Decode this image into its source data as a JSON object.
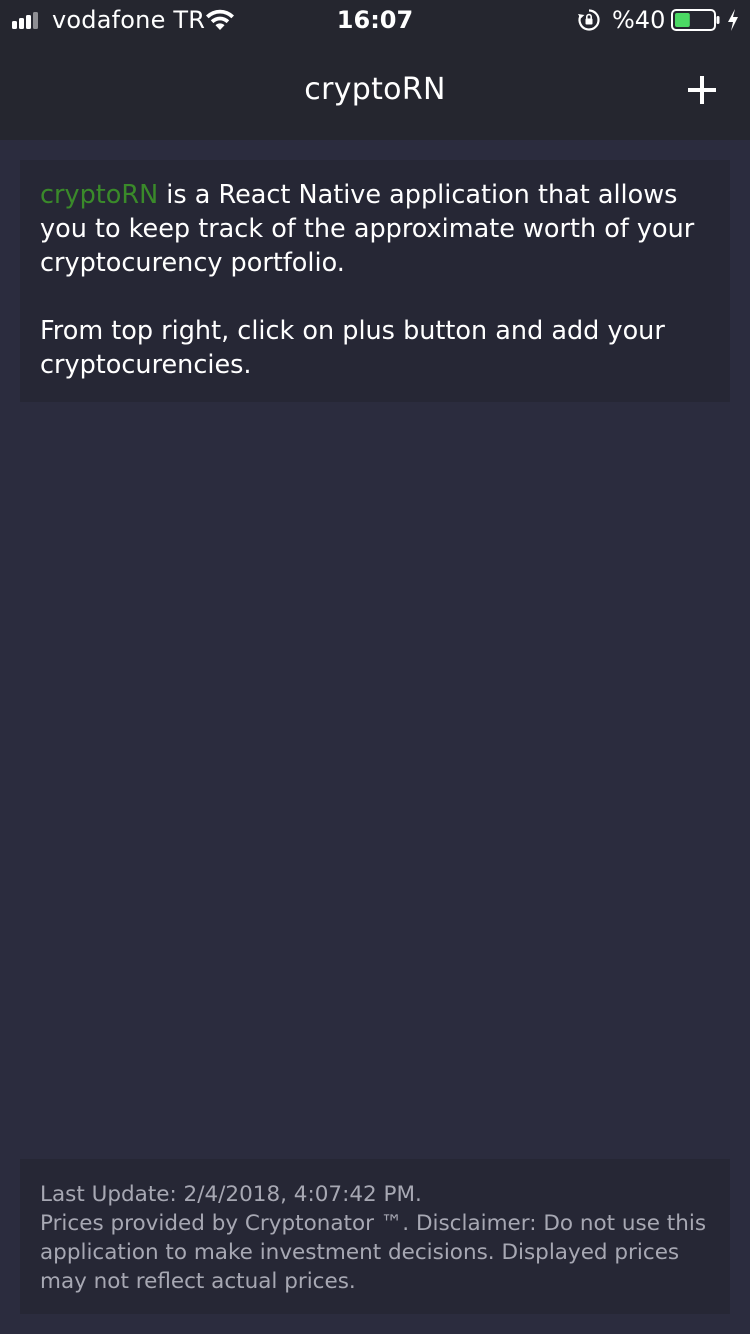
{
  "status_bar": {
    "carrier": "vodafone TR",
    "time": "16:07",
    "battery_percent": "%40",
    "battery_level": 0.4,
    "icons": [
      "signal-icon",
      "wifi-icon",
      "orientation-lock-icon",
      "battery-icon",
      "charging-bolt-icon"
    ]
  },
  "nav": {
    "title": "cryptoRN",
    "add_icon": "plus-icon"
  },
  "intro": {
    "brand": "cryptoRN",
    "paragraph1_rest": " is a React Native application that allows you to keep track of the approximate worth of your cryptocurency portfolio.",
    "paragraph2": "From top right, click on plus button and add your cryptocurencies."
  },
  "footer": {
    "last_update": "Last Update: 2/4/2018, 4:07:42 PM.",
    "disclaimer": "Prices provided by Cryptonator ™. Disclaimer: Do not use this application to make investment decisions. Displayed prices may not reflect actual prices."
  },
  "colors": {
    "background": "#2b2c3e",
    "bar": "#25262f",
    "card": "#262735",
    "brand_green": "#3a8a2a",
    "footer_text": "#a7a8b3",
    "battery_fill": "#4cd964"
  }
}
